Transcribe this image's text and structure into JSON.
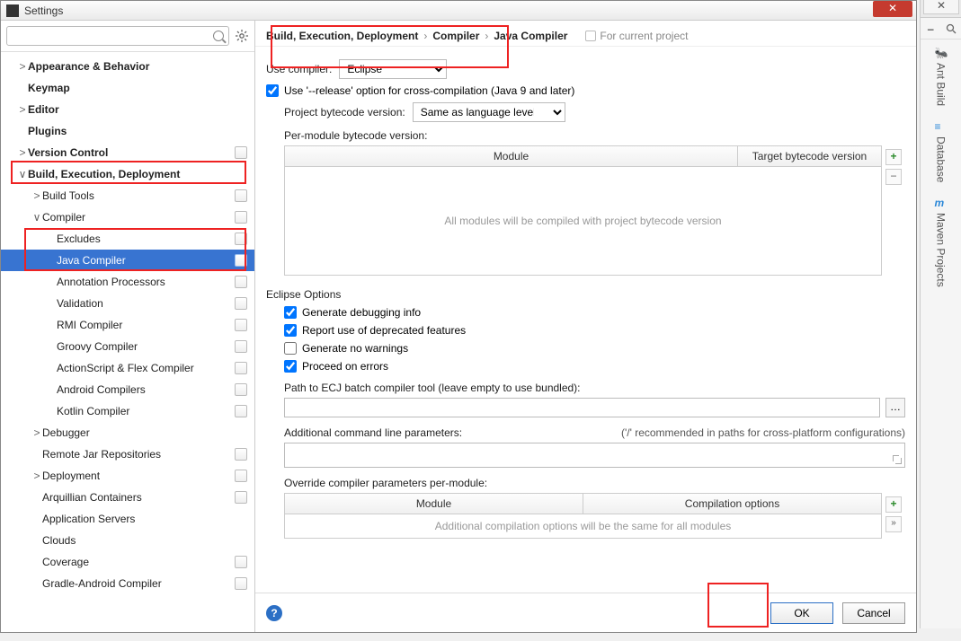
{
  "window": {
    "title": "Settings",
    "close_label": "✕"
  },
  "search": {
    "placeholder": ""
  },
  "tree": [
    {
      "label": "Appearance & Behavior",
      "depth": 1,
      "arrow": ">",
      "bold": true
    },
    {
      "label": "Keymap",
      "depth": 1,
      "arrow": "",
      "bold": true
    },
    {
      "label": "Editor",
      "depth": 1,
      "arrow": ">",
      "bold": true
    },
    {
      "label": "Plugins",
      "depth": 1,
      "arrow": "",
      "bold": true
    },
    {
      "label": "Version Control",
      "depth": 1,
      "arrow": ">",
      "bold": true,
      "badge": true
    },
    {
      "label": "Build, Execution, Deployment",
      "depth": 1,
      "arrow": "∨",
      "bold": true
    },
    {
      "label": "Build Tools",
      "depth": 2,
      "arrow": ">",
      "badge": true
    },
    {
      "label": "Compiler",
      "depth": 2,
      "arrow": "∨",
      "badge": true
    },
    {
      "label": "Excludes",
      "depth": 3,
      "arrow": "",
      "badge": true
    },
    {
      "label": "Java Compiler",
      "depth": 3,
      "arrow": "",
      "badge": true,
      "selected": true
    },
    {
      "label": "Annotation Processors",
      "depth": 3,
      "arrow": "",
      "badge": true
    },
    {
      "label": "Validation",
      "depth": 3,
      "arrow": "",
      "badge": true
    },
    {
      "label": "RMI Compiler",
      "depth": 3,
      "arrow": "",
      "badge": true
    },
    {
      "label": "Groovy Compiler",
      "depth": 3,
      "arrow": "",
      "badge": true
    },
    {
      "label": "ActionScript & Flex Compiler",
      "depth": 3,
      "arrow": "",
      "badge": true
    },
    {
      "label": "Android Compilers",
      "depth": 3,
      "arrow": "",
      "badge": true
    },
    {
      "label": "Kotlin Compiler",
      "depth": 3,
      "arrow": "",
      "badge": true
    },
    {
      "label": "Debugger",
      "depth": 2,
      "arrow": ">"
    },
    {
      "label": "Remote Jar Repositories",
      "depth": 2,
      "arrow": "",
      "badge": true
    },
    {
      "label": "Deployment",
      "depth": 2,
      "arrow": ">",
      "badge": true
    },
    {
      "label": "Arquillian Containers",
      "depth": 2,
      "arrow": "",
      "badge": true
    },
    {
      "label": "Application Servers",
      "depth": 2,
      "arrow": ""
    },
    {
      "label": "Clouds",
      "depth": 2,
      "arrow": ""
    },
    {
      "label": "Coverage",
      "depth": 2,
      "arrow": "",
      "badge": true
    },
    {
      "label": "Gradle-Android Compiler",
      "depth": 2,
      "arrow": "",
      "badge": true
    }
  ],
  "crumbs": {
    "seg1": "Build, Execution, Deployment",
    "seg2": "Compiler",
    "seg3": "Java Compiler",
    "hint": "For current project"
  },
  "form": {
    "use_compiler_label": "Use compiler:",
    "use_compiler_value": "Eclipse",
    "release_opt": "Use '--release' option for cross-compilation (Java 9 and later)",
    "bytecode_label": "Project bytecode version:",
    "bytecode_value": "Same as language level",
    "permodule_label": "Per-module bytecode version:",
    "module_col": "Module",
    "target_col": "Target bytecode version",
    "table_empty": "All modules will be compiled with project bytecode version",
    "eclipse_title": "Eclipse Options",
    "gen_debug": "Generate debugging info",
    "report_deprecated": "Report use of deprecated features",
    "gen_nowarn": "Generate no warnings",
    "proceed_err": "Proceed on errors",
    "ecj_label": "Path to ECJ batch compiler tool (leave empty to use bundled):",
    "addl_label": "Additional command line parameters:",
    "addl_hint": "('/' recommended in paths for cross-platform configurations)",
    "override_label": "Override compiler parameters per-module:",
    "override_col1": "Module",
    "override_col2": "Compilation options",
    "override_empty": "Additional compilation options will be the same for all modules"
  },
  "footer": {
    "ok": "OK",
    "cancel": "Cancel"
  },
  "right_tools": {
    "ant": "Ant Build",
    "db": "Database",
    "maven": "Maven Projects"
  }
}
